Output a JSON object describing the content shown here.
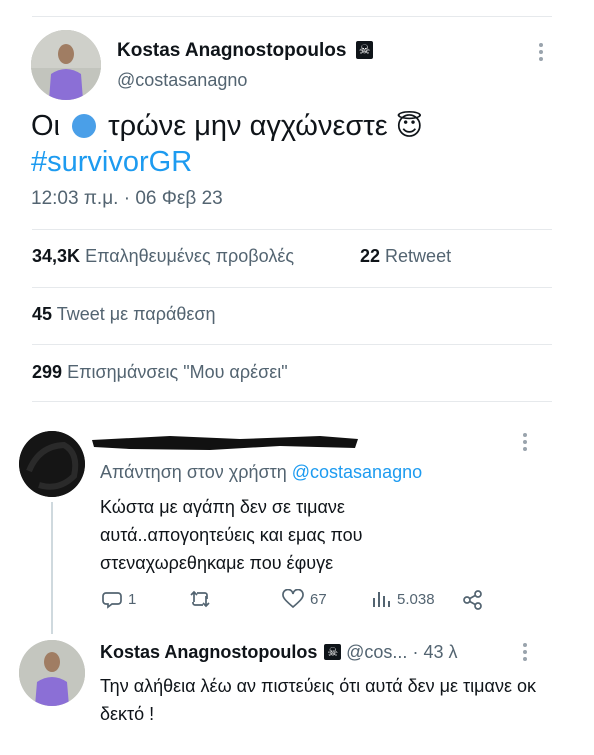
{
  "tweet": {
    "author_name": "Kostas Anagnostopoulos",
    "author_badge": "☠",
    "handle": "@costasanagno",
    "text_before": "Οι",
    "text_after": "τρώνε μην αγχώνεστε",
    "emoji": "😇",
    "hashtag": "#survivorGR",
    "timestamp": "12:03 π.μ. · 06 Φεβ 23",
    "stats": {
      "views_count": "34,3K",
      "views_label": "Επαληθευμένες προβολές",
      "retweets_count": "22",
      "retweets_label": "Retweet",
      "quotes_count": "45",
      "quotes_label": "Tweet με παράθεση",
      "likes_count": "299",
      "likes_label": "Επισημάνσεις \"Μου αρέσει\""
    }
  },
  "reply": {
    "reply_prefix": "Απάντηση στον χρήστη",
    "reply_to": "@costasanagno",
    "text": "Κώστα με αγάπη δεν σε τιμανε αυτά..απογοητεύεις και εμας που στεναχωρεθηκαμε που έφυγε",
    "actions": {
      "replies": "1",
      "retweets": "",
      "likes": "67",
      "views": "5.038"
    }
  },
  "reply2": {
    "author_name": "Kostas Anagnostopoulos",
    "author_badge": "☠",
    "handle": "@cos...",
    "time": "· 43 λ",
    "text": "Την αλήθεια λέω αν πιστεύεις ότι αυτά δεν με τιμανε οκ δεκτό !"
  },
  "colors": {
    "accent": "#1d9bf0",
    "text": "#0f1419",
    "muted": "#536471",
    "divider": "#e6e9ec"
  }
}
